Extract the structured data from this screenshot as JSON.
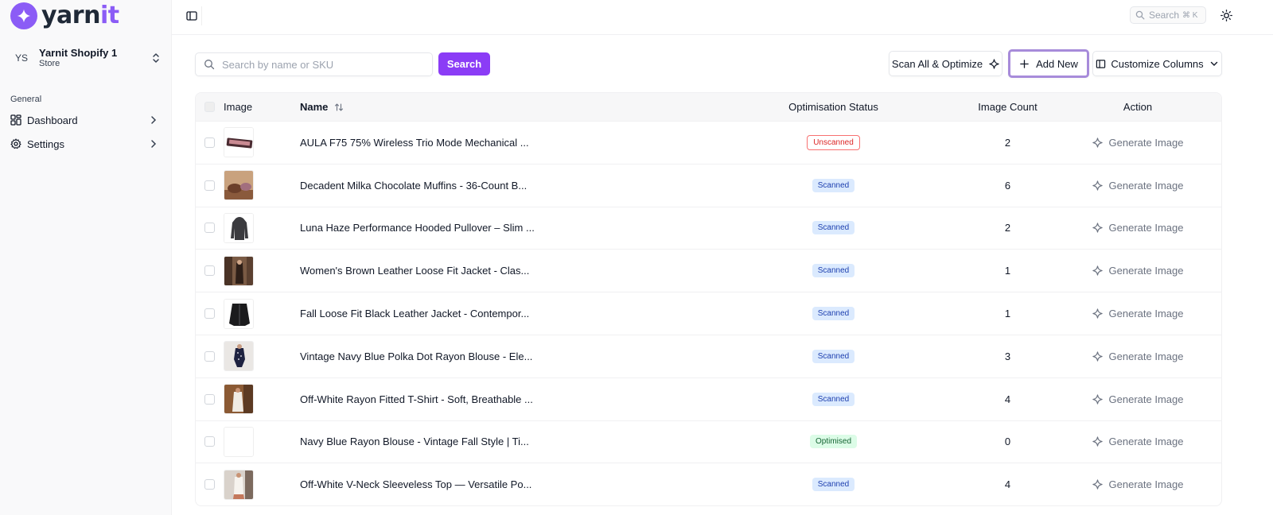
{
  "brand": {
    "name_a": "yarn",
    "name_b": "it",
    "accent": "#8b5cf6"
  },
  "store": {
    "avatar": "YS",
    "name": "Yarnit Shopify 1",
    "type": "Store"
  },
  "sidebar": {
    "section": "General",
    "items": [
      {
        "label": "Dashboard",
        "icon": "dashboard-icon"
      },
      {
        "label": "Settings",
        "icon": "gear-icon"
      }
    ]
  },
  "topbar": {
    "search_label": "Search",
    "shortcut": "⌘ K"
  },
  "toolbar": {
    "search_placeholder": "Search by name or SKU",
    "search_value": "",
    "search_button": "Search",
    "scan_button": "Scan All & Optimize",
    "add_button": "Add New",
    "columns_button": "Customize Columns"
  },
  "table": {
    "headers": {
      "image": "Image",
      "name": "Name",
      "status": "Optimisation Status",
      "count": "Image Count",
      "action": "Action"
    },
    "rows": [
      {
        "name": "AULA F75 75% Wireless Trio Mode Mechanical ...",
        "status": "Unscanned",
        "status_kind": "unscanned",
        "count": "2",
        "action": "Generate Image",
        "thumb": "keyboard"
      },
      {
        "name": "Decadent Milka Chocolate Muffins - 36-Count B...",
        "status": "Scanned",
        "status_kind": "scanned",
        "count": "6",
        "action": "Generate Image",
        "thumb": "muffins"
      },
      {
        "name": "Luna Haze Performance Hooded Pullover – Slim ...",
        "status": "Scanned",
        "status_kind": "scanned",
        "count": "2",
        "action": "Generate Image",
        "thumb": "hoodie"
      },
      {
        "name": "Women's Brown Leather Loose Fit Jacket - Clas...",
        "status": "Scanned",
        "status_kind": "scanned",
        "count": "1",
        "action": "Generate Image",
        "thumb": "brownjacket"
      },
      {
        "name": "Fall Loose Fit Black Leather Jacket - Contempor...",
        "status": "Scanned",
        "status_kind": "scanned",
        "count": "1",
        "action": "Generate Image",
        "thumb": "blackjacket"
      },
      {
        "name": "Vintage Navy Blue Polka Dot Rayon Blouse - Ele...",
        "status": "Scanned",
        "status_kind": "scanned",
        "count": "3",
        "action": "Generate Image",
        "thumb": "polka"
      },
      {
        "name": "Off-White Rayon Fitted T-Shirt - Soft, Breathable ...",
        "status": "Scanned",
        "status_kind": "scanned",
        "count": "4",
        "action": "Generate Image",
        "thumb": "offwhite"
      },
      {
        "name": "Navy Blue Rayon Blouse - Vintage Fall Style | Ti...",
        "status": "Optimised",
        "status_kind": "optimised",
        "count": "0",
        "action": "Generate Image",
        "thumb": "empty"
      },
      {
        "name": "Off-White V-Neck Sleeveless Top — Versatile Po...",
        "status": "Scanned",
        "status_kind": "scanned",
        "count": "4",
        "action": "Generate Image",
        "thumb": "vneck"
      }
    ]
  }
}
